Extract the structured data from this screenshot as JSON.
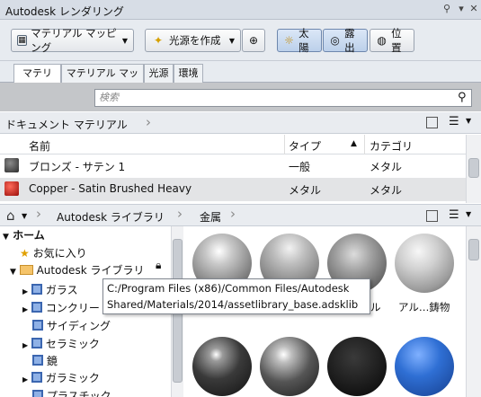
{
  "window": {
    "title": "Autodesk レンダリング"
  },
  "toolbar": {
    "material_mapping_button": "マテリアル マッピング",
    "create_light_button": "光源を作成",
    "sun_button": "太陽",
    "exposure_button": "露出",
    "location_button": "位置"
  },
  "tabs": [
    "マテリアル",
    "マテリアル マッピング",
    "光源",
    "環境"
  ],
  "search": {
    "placeholder": "検索"
  },
  "doc_materials": {
    "breadcrumb": "ドキュメント マテリアル",
    "columns": {
      "name": "名前",
      "type": "タイプ",
      "category": "カテゴリ"
    },
    "rows": [
      {
        "name": "ブロンズ - サテン 1",
        "type": "一般",
        "category": "メタル",
        "swatch_color": "#3a3a3a"
      },
      {
        "name": "Copper - Satin Brushed Heavy",
        "type": "メタル",
        "category": "メタル",
        "swatch_color": "#c0201c"
      }
    ]
  },
  "library": {
    "breadcrumb": [
      "Autodesk ライブラリ",
      "金属"
    ],
    "tree": [
      {
        "label": "ホーム",
        "level": 0
      },
      {
        "label": "お気に入り",
        "level": 1
      },
      {
        "label": "Autodesk ライブラリ",
        "level": 1
      },
      {
        "label": "ガラス",
        "level": 2
      },
      {
        "label": "コンクリー",
        "level": 2
      },
      {
        "label": "サイディング",
        "level": 2
      },
      {
        "label": "セラミック",
        "level": 2
      },
      {
        "label": "鏡",
        "level": 2
      },
      {
        "label": "ガラミック",
        "level": 2
      },
      {
        "label": "プラスチック",
        "level": 2
      }
    ],
    "tooltip": {
      "line1": "C:/Program Files (x86)/Common Files/Autodesk",
      "line2": "Shared/Materials/2014/assetlibrary_base.adsklib"
    },
    "visible_labels": [
      "ル",
      "アル…鋳物"
    ]
  },
  "colors": {
    "accent": "#3b66b0",
    "header_bg": "#d7dde6",
    "search_bg": "#c4c6c9"
  }
}
